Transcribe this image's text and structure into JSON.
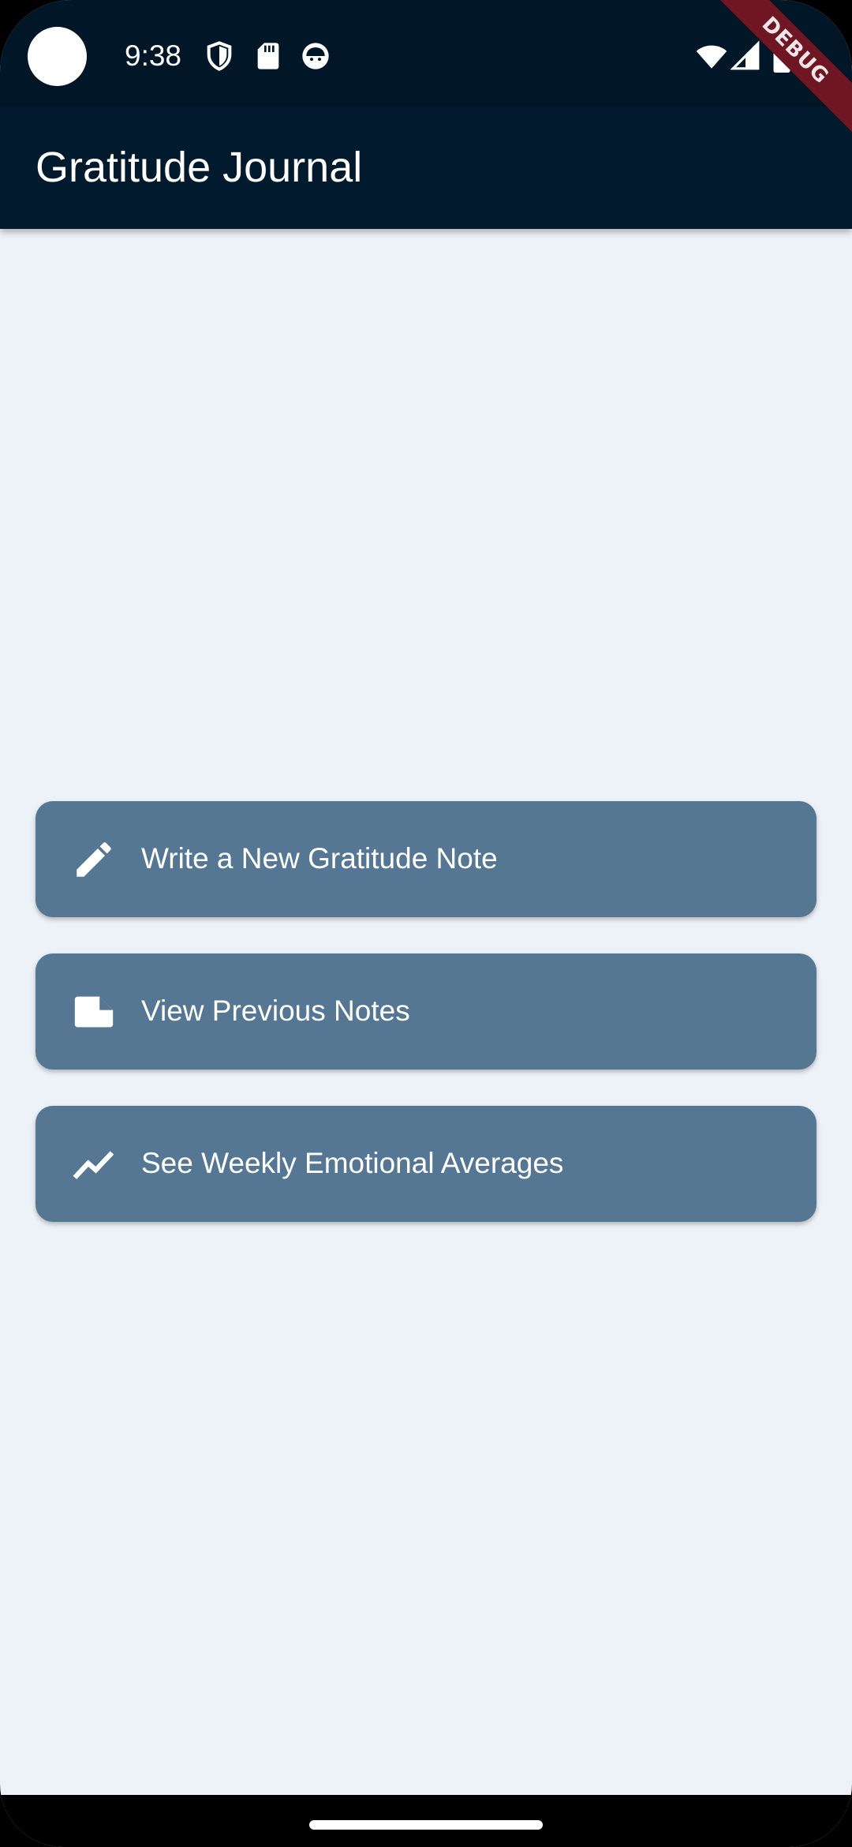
{
  "status_bar": {
    "time": "9:38",
    "icons": [
      "shield-icon",
      "sd-card-icon",
      "notification-face-icon",
      "wifi-icon",
      "signal-icon",
      "battery-icon"
    ]
  },
  "app_bar": {
    "title": "Gratitude Journal"
  },
  "debug_banner": {
    "label": "DEBUG"
  },
  "menu": {
    "items": [
      {
        "label": "Write a New Gratitude Note",
        "icon": "pencil-icon"
      },
      {
        "label": "View Previous Notes",
        "icon": "note-icon"
      },
      {
        "label": "See Weekly Emotional Averages",
        "icon": "trending-up-icon"
      }
    ]
  },
  "colors": {
    "status_bar_bg": "#011627",
    "app_bar_bg": "#011A2E",
    "body_bg": "#EDF1F8",
    "button_bg": "#557794",
    "debug_banner_bg": "#6E1622",
    "text_on_dark": "#FFFFFF"
  }
}
